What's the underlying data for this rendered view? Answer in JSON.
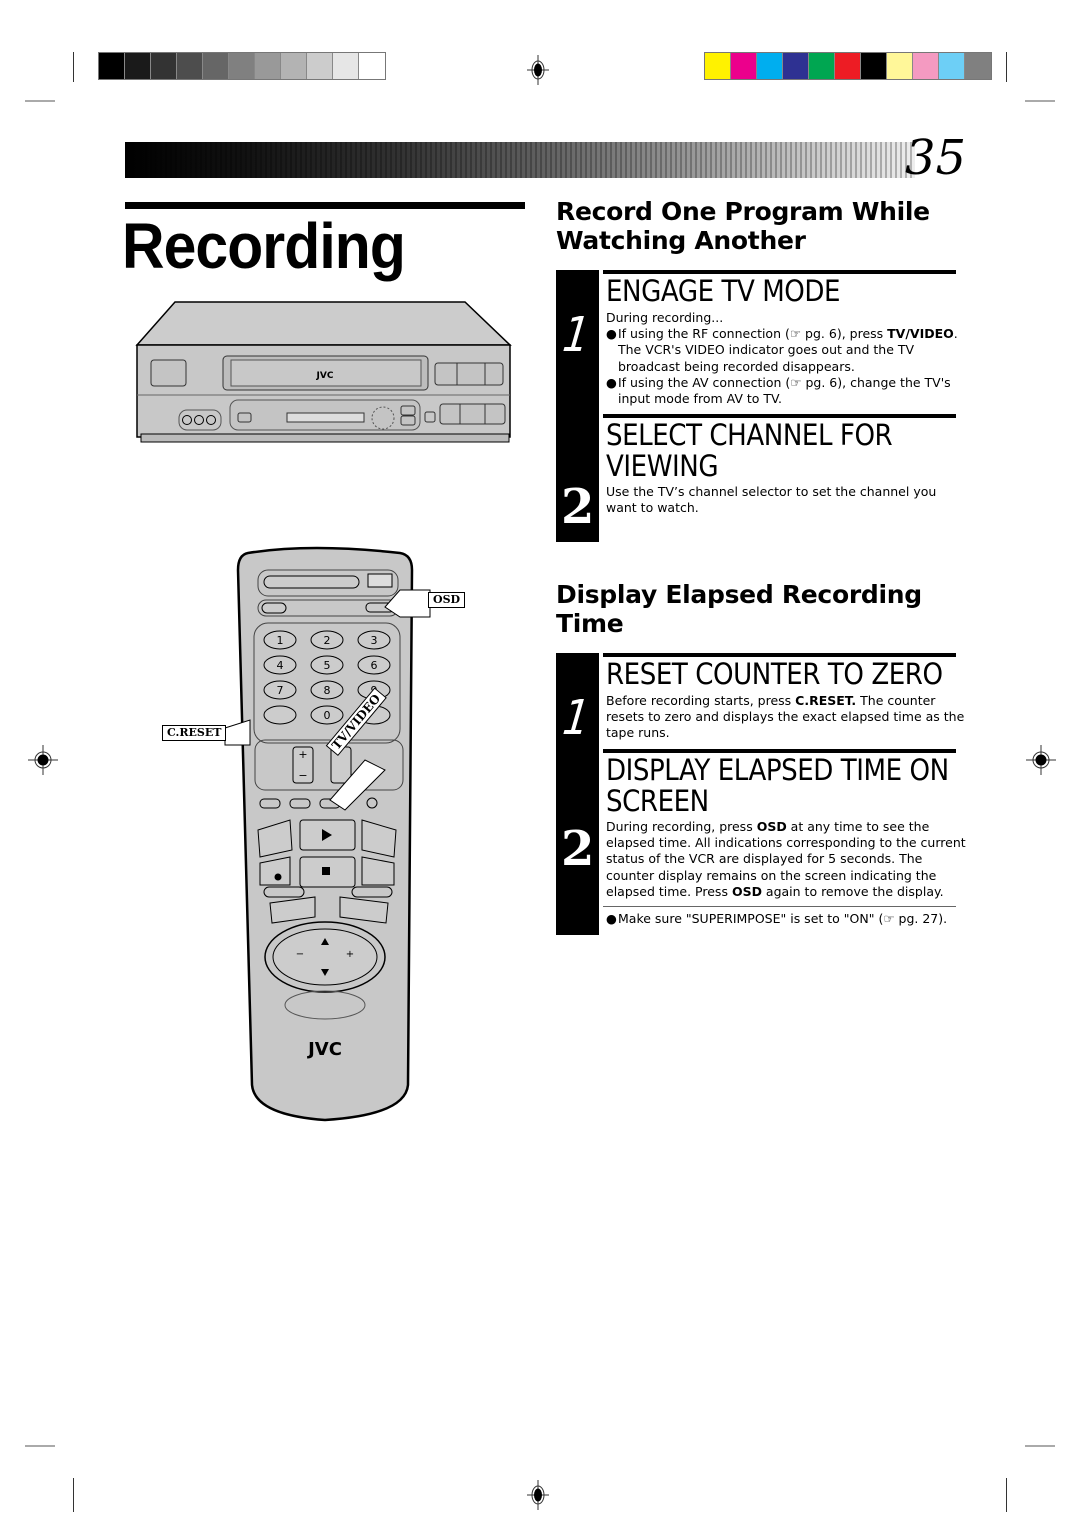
{
  "print_marks": {
    "gray_swatches": [
      "#000000",
      "#1a1a1a",
      "#333333",
      "#4d4d4d",
      "#666666",
      "#808080",
      "#999999",
      "#b3b3b3",
      "#cccccc",
      "#e6e6e6",
      "#ffffff"
    ],
    "color_swatches": [
      "#fff200",
      "#ec008c",
      "#00aeef",
      "#2e3192",
      "#00a651",
      "#ed1c24",
      "#000000",
      "#fff799",
      "#f49ac1",
      "#6dcff6",
      "#808080"
    ]
  },
  "header": {
    "page_number": "35",
    "title": "Recording"
  },
  "section1": {
    "heading_line1": "Record One Program While",
    "heading_line2": "Watching Another",
    "steps": [
      {
        "number": "1",
        "heading": "ENGAGE TV MODE",
        "intro": "During recording...",
        "bullets": [
          {
            "pre": "If using the RF connection (",
            "ref_icon": "☞",
            "mid": " pg. 6), press ",
            "bold": "TV/VIDEO",
            "post": ". The VCR's VIDEO indicator goes out and the TV broadcast being recorded disappears."
          },
          {
            "pre": "If using the AV connection (",
            "ref_icon": "☞",
            "mid": " pg. 6), change the TV's input mode from AV to TV.",
            "bold": "",
            "post": ""
          }
        ]
      },
      {
        "number": "2",
        "heading_line1": "SELECT CHANNEL FOR",
        "heading_line2": "VIEWING",
        "body": "Use the TV’s channel selector to set the channel you want to watch."
      }
    ]
  },
  "section2": {
    "heading_line1": "Display Elapsed Recording",
    "heading_line2": "Time",
    "steps": [
      {
        "number": "1",
        "heading": "RESET COUNTER TO ZERO",
        "body_pre": "Before recording starts, press ",
        "body_bold": "C.RESET.",
        "body_post": " The counter resets to zero and displays the exact elapsed time as the tape runs."
      },
      {
        "number": "2",
        "heading_line1": "DISPLAY ELAPSED TIME ON",
        "heading_line2": "SCREEN",
        "body_pre": "During recording, press ",
        "body_bold1": "OSD",
        "body_mid": " at any time to see the elapsed time. All indications corresponding to the current status of the VCR are displayed for 5 seconds. The counter display remains on the screen indicating the elapsed time. Press ",
        "body_bold2": "OSD",
        "body_post": " again to remove the display.",
        "note_pre": "Make sure \"SUPERIMPOSE\" is set to \"ON\" (",
        "note_icon": "☞",
        "note_post": " pg. 27)."
      }
    ]
  },
  "illustrations": {
    "vcr_brand": "JVC",
    "remote_brand": "JVC",
    "callout_osd": "OSD",
    "callout_creset": "C.RESET",
    "callout_tvvideo": "TV/VIDEO",
    "keypad": [
      "1",
      "2",
      "3",
      "4",
      "5",
      "6",
      "7",
      "8",
      "9",
      "0"
    ]
  }
}
